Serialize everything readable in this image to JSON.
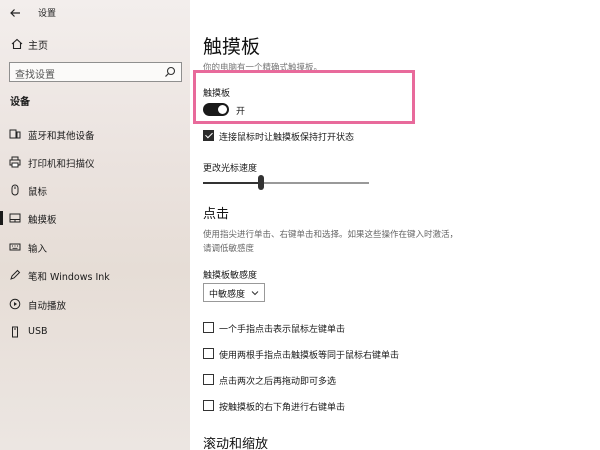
{
  "window": {
    "title": "设置"
  },
  "sidebar": {
    "home_label": "主页",
    "search_placeholder": "查找设置",
    "section_title": "设备",
    "items": [
      {
        "label": "蓝牙和其他设备",
        "icon": "bluetooth-devices-icon"
      },
      {
        "label": "打印机和扫描仪",
        "icon": "printer-icon"
      },
      {
        "label": "鼠标",
        "icon": "mouse-icon"
      },
      {
        "label": "触摸板",
        "icon": "touchpad-icon",
        "active": true
      },
      {
        "label": "输入",
        "icon": "keyboard-icon"
      },
      {
        "label": "笔和 Windows Ink",
        "icon": "pen-icon"
      },
      {
        "label": "自动播放",
        "icon": "autoplay-icon"
      },
      {
        "label": "USB",
        "icon": "usb-icon"
      }
    ]
  },
  "main": {
    "title": "触摸板",
    "subtext": "你的电脑有一个精确式触摸板。",
    "touchpad_toggle": {
      "label": "触摸板",
      "state": "开",
      "on": true
    },
    "keep_on_mouse": {
      "label": "连接鼠标时让触摸板保持打开状态",
      "checked": true
    },
    "cursor_speed": {
      "label": "更改光标速度",
      "value": 0.35
    },
    "taps": {
      "heading": "点击",
      "description": "使用指尖进行单击、右键单击和选择。如果这些操作在键入时激活，请调低敏感度",
      "sensitivity_label": "触摸板敏感度",
      "sensitivity_value": "中敏感度",
      "options": [
        {
          "label": "一个手指点击表示鼠标左键单击",
          "checked": false
        },
        {
          "label": "使用两根手指点击触摸板等同于鼠标右键单击",
          "checked": false
        },
        {
          "label": "点击两次之后再拖动即可多选",
          "checked": false
        },
        {
          "label": "按触摸板的右下角进行右键单击",
          "checked": false
        }
      ]
    },
    "scroll_heading": "滚动和缩放"
  },
  "colors": {
    "highlight": "#e86a9b",
    "accent": "#1a1a1a"
  }
}
